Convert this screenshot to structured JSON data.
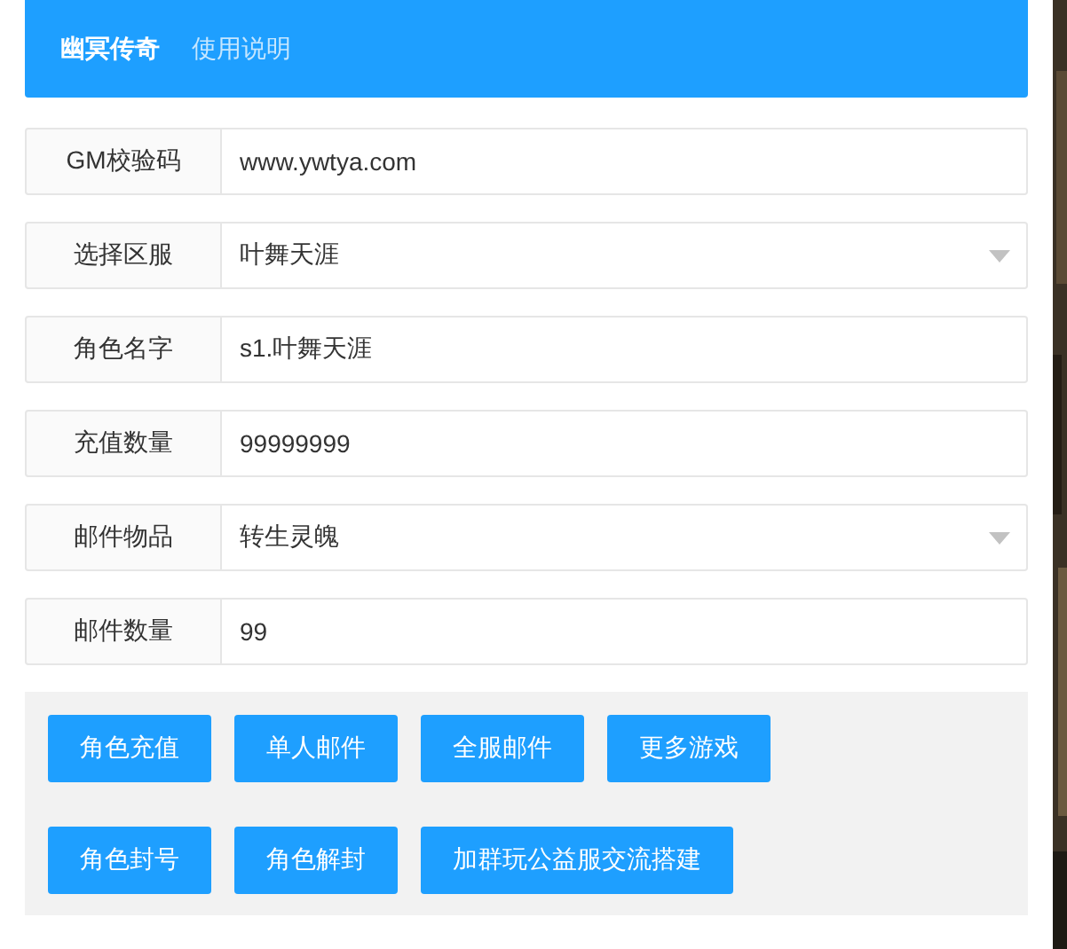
{
  "nav": [
    {
      "label": "幽冥传奇",
      "selected": true
    },
    {
      "label": "使用说明",
      "selected": false
    }
  ],
  "fields": [
    {
      "label": "GM校验码",
      "kind": "input",
      "value": "www.ywtya.com"
    },
    {
      "label": "选择区服",
      "kind": "select",
      "value": "叶舞天涯"
    },
    {
      "label": "角色名字",
      "kind": "input",
      "value": "s1.叶舞天涯"
    },
    {
      "label": "充值数量",
      "kind": "input",
      "value": "99999999"
    },
    {
      "label": "邮件物品",
      "kind": "select",
      "value": "转生灵魄"
    },
    {
      "label": "邮件数量",
      "kind": "input",
      "value": "99"
    }
  ],
  "button_rows": [
    [
      "角色充值",
      "单人邮件",
      "全服邮件",
      "更多游戏"
    ],
    [
      "角色封号",
      "角色解封",
      "加群玩公益服交流搭建"
    ]
  ]
}
